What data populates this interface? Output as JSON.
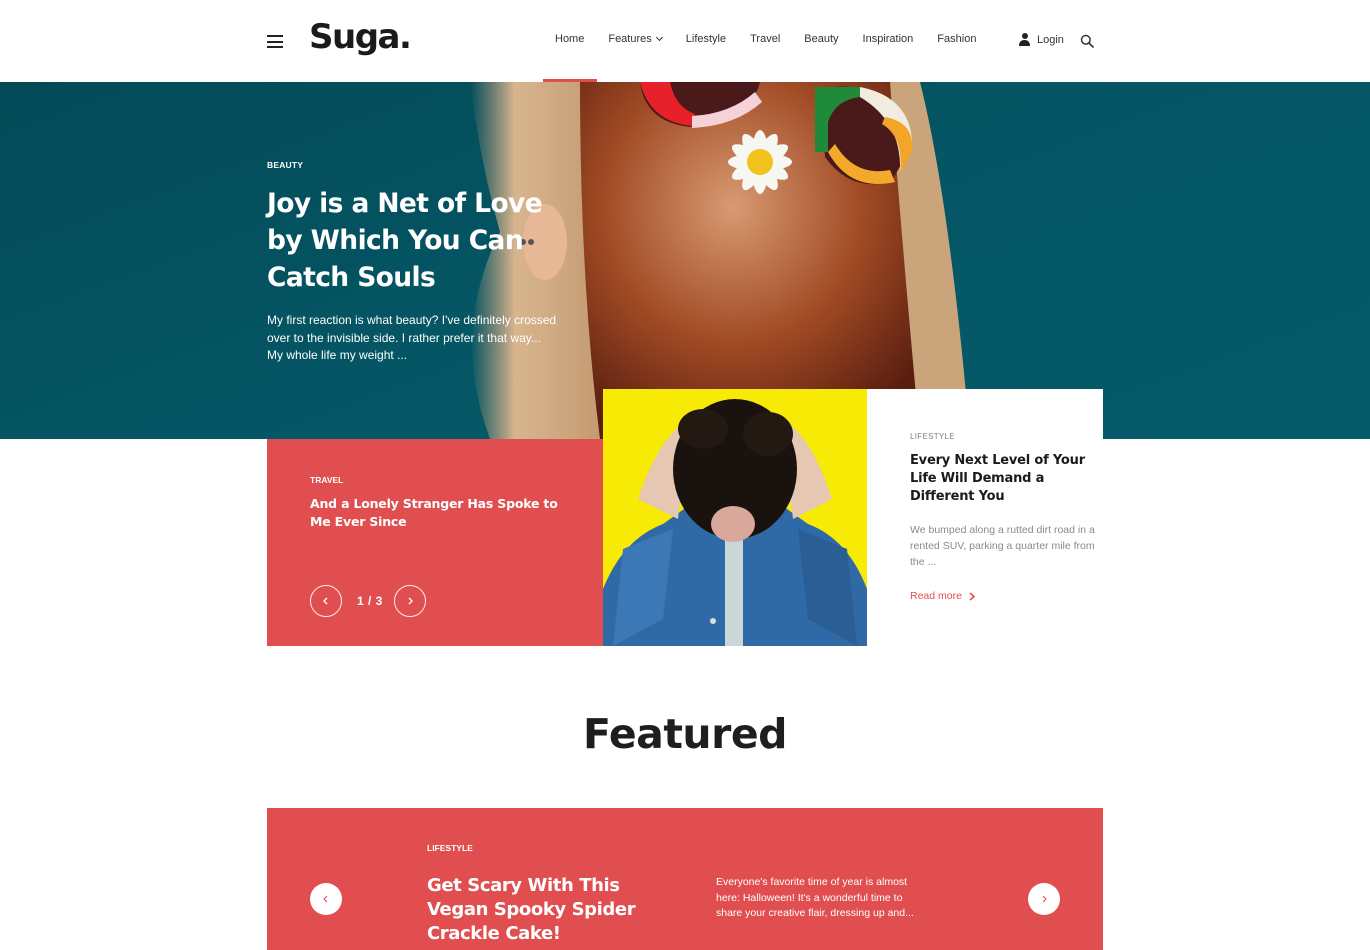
{
  "header": {
    "logo": "Suga.",
    "nav": [
      {
        "label": "Home",
        "active": true
      },
      {
        "label": "Features",
        "has_dropdown": true
      },
      {
        "label": "Lifestyle"
      },
      {
        "label": "Travel"
      },
      {
        "label": "Beauty"
      },
      {
        "label": "Inspiration"
      },
      {
        "label": "Fashion"
      }
    ],
    "login_label": "Login",
    "icons": {
      "menu": "hamburger-icon",
      "user": "user-icon",
      "search": "search-icon"
    }
  },
  "hero": {
    "category": "BEAUTY",
    "title": "Joy is a Net of Love by Which You Can Catch Souls",
    "excerpt": "My first reaction is what beauty? I've definitely crossed over to the invisible side. I rather prefer it that way... My whole life my weight ..."
  },
  "slider": {
    "category": "TRAVEL",
    "title": "And a Lonely Stranger Has Spoke to Me Ever Since",
    "pager": "1 / 3",
    "current_slide": 1,
    "total_slides": 3
  },
  "lifestyle_post": {
    "category": "LIFESTYLE",
    "title": "Every Next Level of Your Life Will Demand a Different You",
    "excerpt": "We bumped along a rutted dirt road in a rented SUV, parking a quarter mile from the ...",
    "read_more": "Read more"
  },
  "featured": {
    "heading": "Featured",
    "post": {
      "category": "LIFESTYLE",
      "title": "Get Scary With This Vegan Spooky Spider Crackle Cake!",
      "excerpt": "Everyone's favorite time of year is almost here: Halloween! It's a wonderful time to share your creative flair, dressing up and..."
    }
  },
  "colors": {
    "accent": "#e04e4f",
    "hero_bg": "#055766",
    "highlight_yellow": "#f7ea05",
    "text_dark": "#1b1b1b",
    "text_muted": "#8a8a8a"
  }
}
